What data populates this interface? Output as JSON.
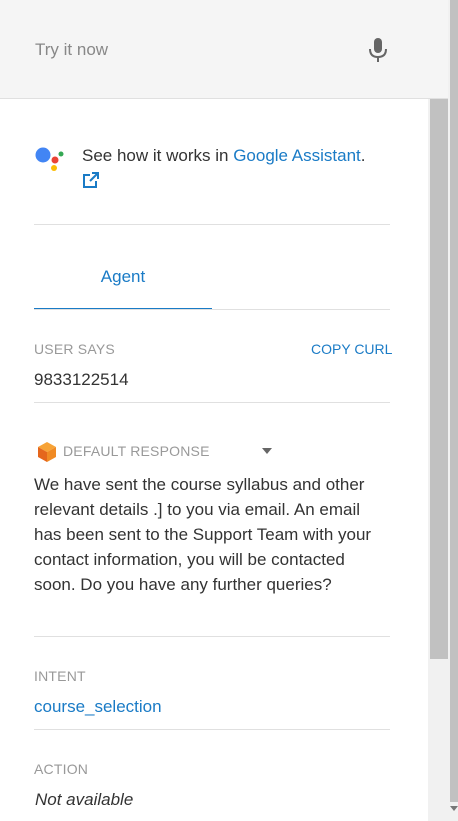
{
  "try_bar": {
    "placeholder": "Try it now"
  },
  "assistant": {
    "prefix": "See how it works in ",
    "link": "Google Assistant",
    "suffix": "."
  },
  "tabs": [
    {
      "label": "Agent",
      "active": true
    }
  ],
  "user_says": {
    "label": "USER SAYS",
    "copy_label": "COPY CURL",
    "value": "9833122514"
  },
  "default_response": {
    "label": "DEFAULT RESPONSE",
    "text": "We have sent the course syllabus and other relevant details .] to you via email. An email has been sent to the Support Team with your contact information, you will be contacted soon. Do you have any further queries?"
  },
  "intent": {
    "label": "INTENT",
    "value": "course_selection"
  },
  "action": {
    "label": "ACTION",
    "value": "Not available"
  },
  "colors": {
    "accent": "#1a7bc6",
    "muted": "#999999",
    "bar": "#f5f5f5"
  }
}
